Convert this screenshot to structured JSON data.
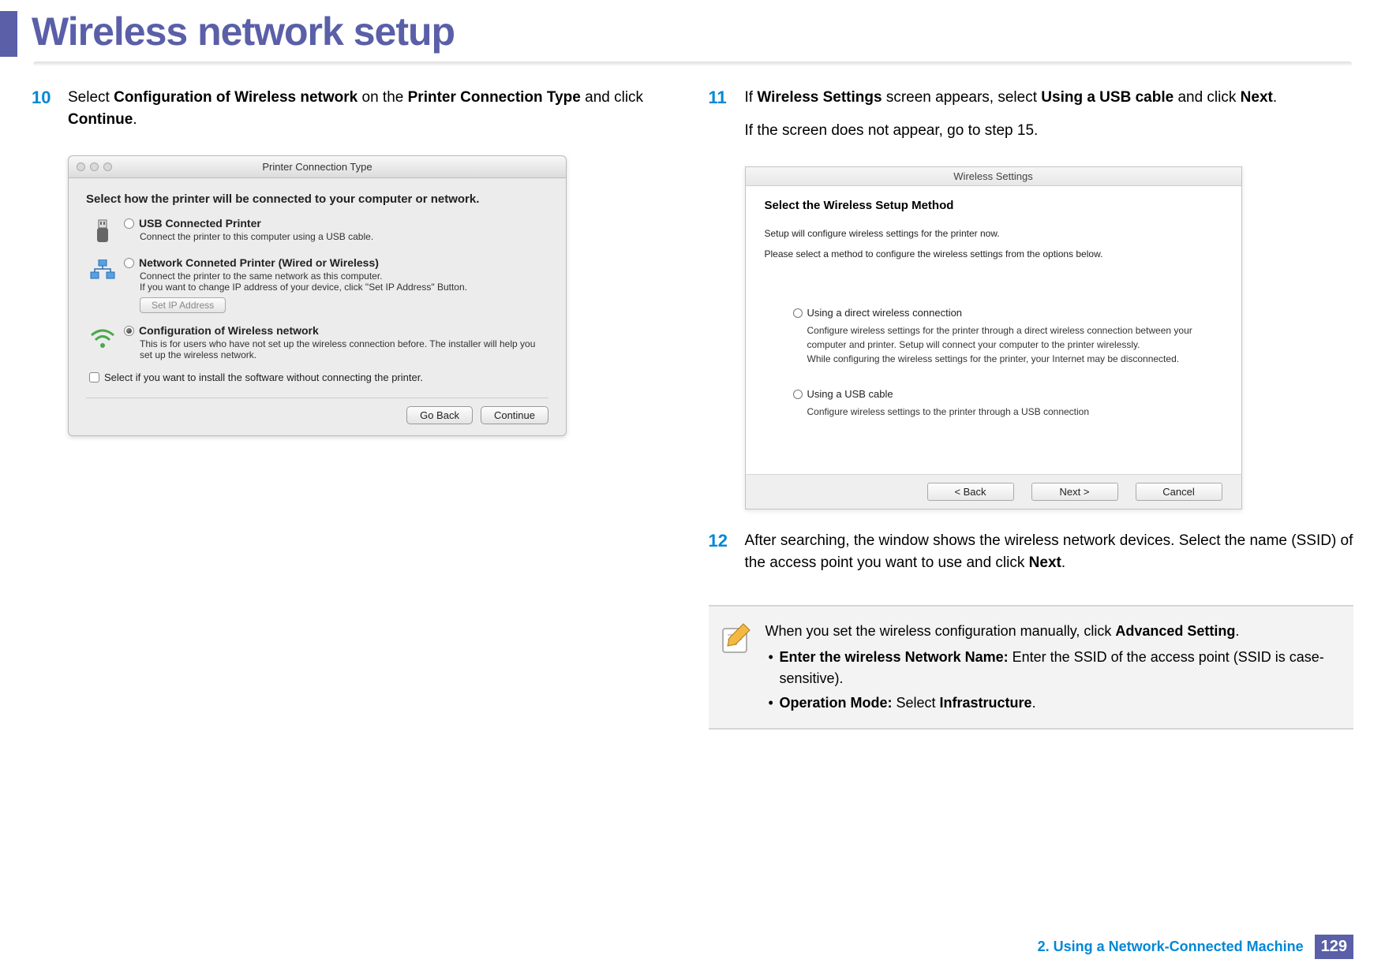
{
  "header": {
    "title": "Wireless network setup"
  },
  "steps": {
    "s10": {
      "num": "10",
      "text_pre": "Select ",
      "b1": "Configuration of Wireless network",
      "text_mid1": " on the ",
      "b2": "Printer Connection Type",
      "text_mid2": " and click ",
      "b3": "Continue",
      "text_post": "."
    },
    "s11": {
      "num": "11",
      "text_pre": "If ",
      "b1": "Wireless Settings",
      "text_mid1": " screen appears, select ",
      "b2": "Using a USB cable",
      "text_mid2": " and click ",
      "b3": "Next",
      "text_post": ".",
      "line2": "If the screen does not appear, go to step 15."
    },
    "s12": {
      "num": "12",
      "text_pre": "After searching, the window shows the wireless network devices. Select the name (SSID) of the access point you want to use and click ",
      "b1": "Next",
      "text_post": "."
    }
  },
  "dialog1": {
    "title": "Printer Connection Type",
    "heading": "Select how the printer will be connected to your computer or network.",
    "opt1": {
      "label": "USB Connected Printer",
      "desc": "Connect the printer to this computer using a USB cable."
    },
    "opt2": {
      "label": "Network Conneted Printer (Wired or Wireless)",
      "desc": "Connect the printer to the same network as this computer.\nIf you want to change IP address of your device, click \"Set IP Address\" Button.",
      "setip": "Set IP Address"
    },
    "opt3": {
      "label": "Configuration of Wireless network",
      "desc": "This is for users who have not set up the wireless connection before. The installer will help you set up the wireless network."
    },
    "checkbox": "Select if you want to install the software without connecting the printer.",
    "btn_back": "Go Back",
    "btn_continue": "Continue"
  },
  "dialog2": {
    "title": "Wireless Settings",
    "heading": "Select the Wireless Setup Method",
    "sub1": "Setup will configure wireless settings for the printer now.",
    "sub2": "Please select a method to configure the wireless settings from the options below.",
    "opt1": {
      "label": "Using a direct wireless connection",
      "desc1": "Configure wireless settings for the printer through a direct wireless connection between your computer and printer. Setup will connect your computer to the printer wirelessly.",
      "desc2": "While configuring the wireless settings for the printer, your Internet may be disconnected."
    },
    "opt2": {
      "label": "Using a USB cable",
      "desc": "Configure wireless settings to the printer through a USB connection"
    },
    "btn_back": "< Back",
    "btn_next": "Next >",
    "btn_cancel": "Cancel"
  },
  "note": {
    "line1_pre": "When you set the wireless configuration manually, click ",
    "line1_b": "Advanced Setting",
    "line1_post": ".",
    "bullet1_b": "Enter the wireless Network Name:",
    "bullet1_rest": " Enter the SSID of the access point (SSID is case-sensitive).",
    "bullet2_b": "Operation Mode:",
    "bullet2_mid": " Select ",
    "bullet2_b2": "Infrastructure",
    "bullet2_post": "."
  },
  "footer": {
    "chapter": "2.  Using a Network-Connected Machine",
    "page": "129"
  }
}
